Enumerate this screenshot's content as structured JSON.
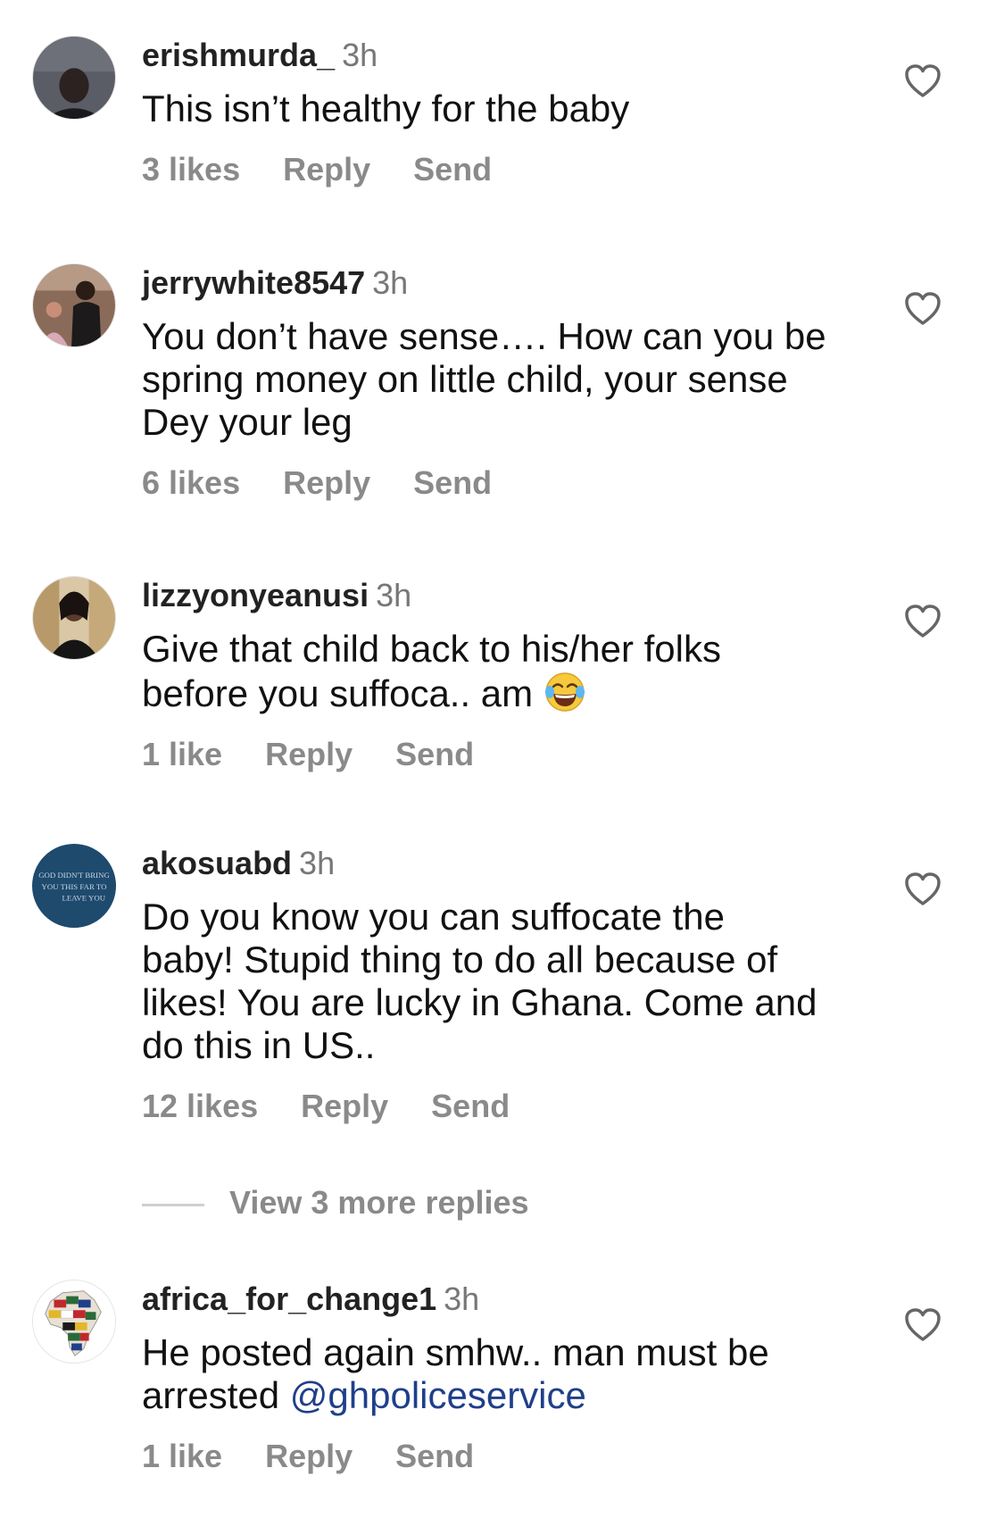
{
  "comments": [
    {
      "username": "erishmurda_",
      "time": "3h",
      "lines": [
        "This isn’t healthy for the baby"
      ],
      "likes": "3 likes",
      "reply": "Reply",
      "send": "Send"
    },
    {
      "username": "jerrywhite8547",
      "time": "3h",
      "lines": [
        "You don’t have sense…. How can you be",
        "spring money on little child, your sense",
        "Dey your leg"
      ],
      "likes": "6 likes",
      "reply": "Reply",
      "send": "Send"
    },
    {
      "username": "lizzyonyeanusi",
      "time": "3h",
      "lines": [
        "Give that child back to his/her folks",
        "before you suffoca.. am"
      ],
      "likes": "1 like",
      "reply": "Reply",
      "send": "Send"
    },
    {
      "username": "akosuabd",
      "time": "3h",
      "lines": [
        "Do you know you can suffocate the",
        "baby! Stupid thing to do all because of",
        "likes! You are lucky in Ghana. Come and",
        "do this in US.."
      ],
      "likes": "12 likes",
      "reply": "Reply",
      "send": "Send",
      "avatar_text": [
        "GOD DIDN'T BRING",
        "YOU THIS FAR TO",
        "LEAVE YOU"
      ]
    },
    {
      "username": "africa_for_change1",
      "time": "3h",
      "lines": [
        "He posted again smhw.. man must be",
        "arrested "
      ],
      "mention": "@ghpoliceservice",
      "likes": "1 like",
      "reply": "Reply",
      "send": "Send"
    }
  ],
  "view_more_replies": "View 3 more replies",
  "icons": {
    "like": "heart-outline-icon",
    "emoji": "face-with-tears-of-joy-emoji"
  },
  "colors": {
    "mention": "#1f3f8a",
    "muted": "#8a8a8a",
    "avatar_akosuabd": "#1e4a6e"
  }
}
